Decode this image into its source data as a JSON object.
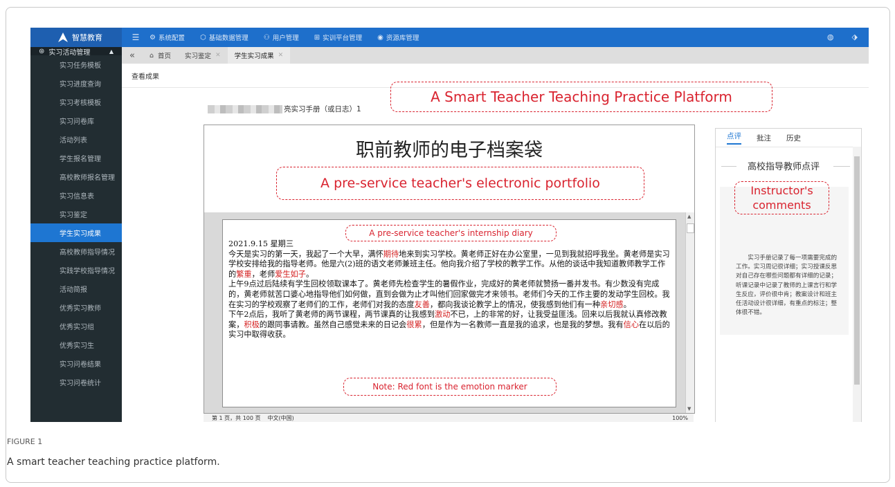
{
  "app": {
    "logo_text": "智慧教育",
    "top_menu": [
      {
        "icon": "monitor-icon",
        "glyph": "⚙",
        "label": "系统配置"
      },
      {
        "icon": "shield-icon",
        "glyph": "⬡",
        "label": "基础数据管理"
      },
      {
        "icon": "user-icon",
        "glyph": "⚇",
        "label": "用户管理"
      },
      {
        "icon": "grid-icon",
        "glyph": "⊞",
        "label": "实训平台管理"
      },
      {
        "icon": "database-icon",
        "glyph": "◉",
        "label": "资源库管理"
      }
    ]
  },
  "sidebar": {
    "section": "实习活动管理",
    "items": [
      "实习任务模板",
      "实习进度查询",
      "实习考核模板",
      "实习问卷库",
      "活动列表",
      "学生报名管理",
      "高校教师报名管理",
      "实习信息表",
      "实习鉴定",
      "学生实习成果",
      "高校教师指导情况",
      "实践学校指导情况",
      "活动简报",
      "优秀实习教师",
      "优秀实习组",
      "优秀实习生",
      "实习问卷结果",
      "实习问卷统计"
    ],
    "active_index": 9
  },
  "tabs": {
    "items": [
      "首页",
      "实习鉴定",
      "学生实习成果"
    ],
    "active_index": 2
  },
  "content": {
    "breadcrumb": "查看成果",
    "doc_title": "亮实习手册（或日志）1",
    "heading": "职前教师的电子档案袋",
    "diary": [
      {
        "t": "2021.9.15 星期三\n今天是实习的第一天，我起了一个大早，满怀"
      },
      {
        "t": "期待",
        "red": true
      },
      {
        "t": "地来到实习学校。黄老师正好在办公室里，一见到我就招呼我坐。黄老师是实习学校安排给我的指导老师。他是六(2)班的语文老师兼班主任。他向我介绍了学校的教学工作。从他的谈话中我知道教师教学工作的"
      },
      {
        "t": "繁重",
        "red": true
      },
      {
        "t": "，老师"
      },
      {
        "t": "爱生如子",
        "red": true
      },
      {
        "t": "。\n上午9点过后陆续有学生回校领取课本了。黄老师先检查学生的暑假作业，完成好的黄老师就赞扬一番并发书。有少数没有完成的，黄老师就苦口婆心地指导他们如何做，直到会做为止才叫他们回家做完才来领书。老师们今天的工作主要的发动学生回校。我在实习的学校观察了老师们的工作，老师们对我的态度"
      },
      {
        "t": "友善",
        "red": true
      },
      {
        "t": "，都向我谈论教学上的情况，使我感到他们有一种"
      },
      {
        "t": "亲切感",
        "red": true
      },
      {
        "t": "。\n下午2点后，我听了黄老师的两节课程，两节课真的让我感到"
      },
      {
        "t": "激动",
        "red": true
      },
      {
        "t": "不已，上的非常的好，让我受益匪浅。回来以后我就认真修改教案，"
      },
      {
        "t": "积极",
        "red": true
      },
      {
        "t": "的跟同事请教。虽然自己感觉未来的日记会"
      },
      {
        "t": "很累",
        "red": true
      },
      {
        "t": "，但是作为一名教师一直是我的追求，也是我的梦想。我有"
      },
      {
        "t": "信心",
        "red": true
      },
      {
        "t": "在以后的实习中取得收获。"
      }
    ],
    "status_page": "第 1 页，共 100 页",
    "status_lang": "中文(中国)",
    "status_zoom": "100%"
  },
  "right_panel": {
    "tabs": [
      "点评",
      "批注",
      "历史"
    ],
    "active_index": 0,
    "heading": "高校指导教师点评",
    "comment": "实习手册记录了每一项需要完成的工作。实习周记很详细；实习授课反思对自己存在哪些问题都有详细的记录；听课记录中记录了教师的上课言行和学生反应，评价很中肯；教案设计和班主任活动设计很详细，有重点的标注；整体很不错。"
  },
  "annotations": {
    "platform": "A Smart Teacher Teaching Practice Platform",
    "portfolio": "A pre-service teacher's electronic portfolio",
    "diary": "A pre-service teacher's internship diary",
    "instructor": "Instructor's comments",
    "note": "Note: Red font is the emotion marker"
  },
  "figure": {
    "label": "FIGURE 1",
    "caption": "A smart teacher teaching practice platform."
  },
  "colors": {
    "topbar": "#1e6fcb",
    "sidebar": "#222d32",
    "active": "#1e76d2",
    "annotation": "#d9232f",
    "emotion": "#d42020"
  }
}
